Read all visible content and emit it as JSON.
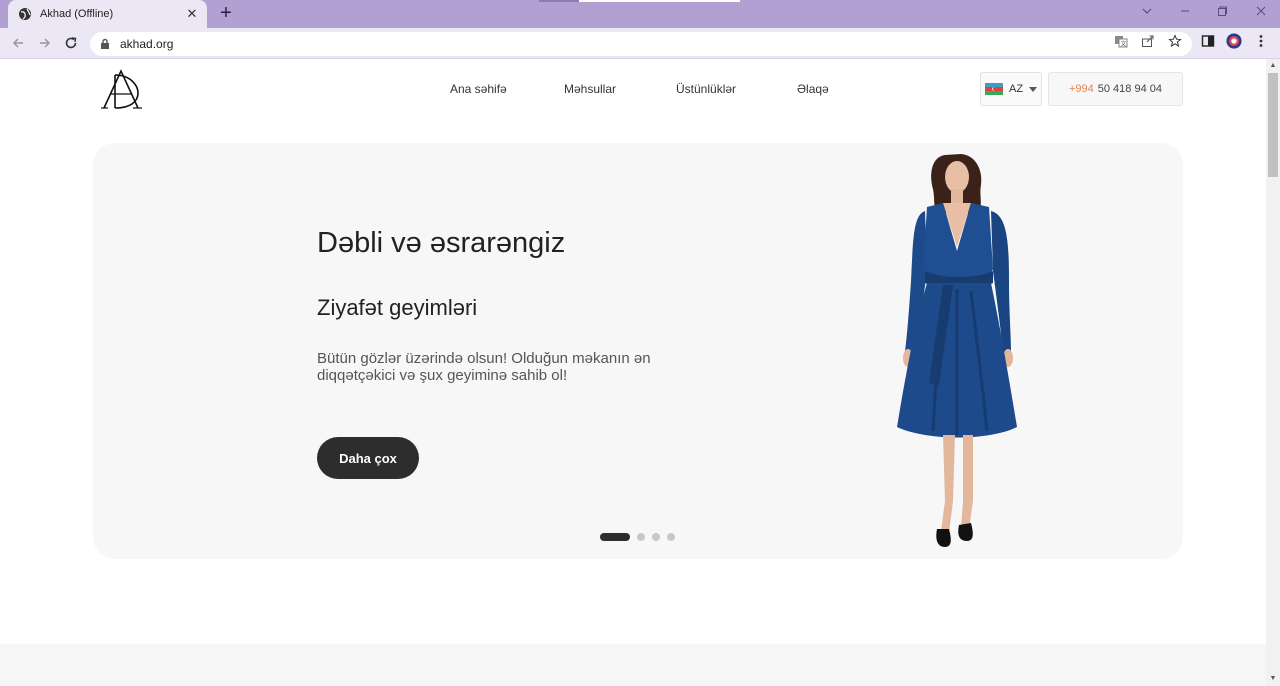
{
  "browser": {
    "tab_title": "Akhad (Offline)",
    "new_tab_label": "+",
    "url": "akhad.org"
  },
  "site": {
    "nav": [
      {
        "label": "Ana səhifə"
      },
      {
        "label": "Məhsullar"
      },
      {
        "label": "Üstünlüklər"
      },
      {
        "label": "Əlaqə"
      }
    ],
    "lang": "AZ",
    "phone_code": "+994",
    "phone_number": "50 418 94 04"
  },
  "hero": {
    "title": "Dəbli və əsrarəngiz",
    "subtitle": "Ziyafət geyimləri",
    "text": "Bütün gözlər üzərində olsun! Olduğun məkanın ən diqqətçəkici və şux geyiminə sahib ol!",
    "button": "Daha çox",
    "slides": 4,
    "active_slide": 1
  },
  "colors": {
    "accent_phone": "#e6844a",
    "dark_button": "#2d2d2d",
    "hero_bg": "#f7f7f7",
    "dress_blue": "#1d4a8a",
    "chrome_tab_bar": "#b3a0d3"
  }
}
